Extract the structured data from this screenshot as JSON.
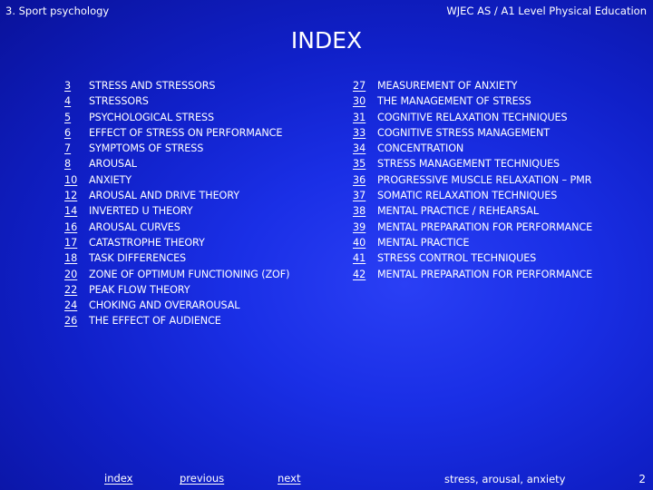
{
  "header": {
    "left": "3. Sport psychology",
    "right": "WJEC AS / A1 Level Physical Education"
  },
  "title": "INDEX",
  "left_entries": [
    {
      "page": "3",
      "label": "STRESS AND STRESSORS"
    },
    {
      "page": "4",
      "label": "STRESSORS"
    },
    {
      "page": "5",
      "label": "PSYCHOLOGICAL STRESS"
    },
    {
      "page": "6",
      "label": "EFFECT OF STRESS ON PERFORMANCE"
    },
    {
      "page": "7",
      "label": "SYMPTOMS OF STRESS"
    },
    {
      "page": "8",
      "label": "AROUSAL"
    },
    {
      "page": "10",
      "label": "ANXIETY"
    },
    {
      "page": "12",
      "label": "AROUSAL AND DRIVE THEORY"
    },
    {
      "page": "14",
      "label": "INVERTED U THEORY"
    },
    {
      "page": "16",
      "label": "AROUSAL CURVES"
    },
    {
      "page": "17",
      "label": "CATASTROPHE THEORY"
    },
    {
      "page": "18",
      "label": "TASK DIFFERENCES"
    },
    {
      "page": "20",
      "label": "ZONE OF OPTIMUM FUNCTIONING (ZOF)"
    },
    {
      "page": "22",
      "label": "PEAK FLOW THEORY"
    },
    {
      "page": "24",
      "label": "CHOKING AND OVERAROUSAL"
    },
    {
      "page": "26",
      "label": "THE EFFECT OF AUDIENCE"
    }
  ],
  "right_entries": [
    {
      "page": "27",
      "label": "MEASUREMENT OF ANXIETY"
    },
    {
      "page": "30",
      "label": "THE MANAGEMENT OF STRESS"
    },
    {
      "page": "31",
      "label": "COGNITIVE RELAXATION TECHNIQUES"
    },
    {
      "page": "33",
      "label": "COGNITIVE STRESS MANAGEMENT"
    },
    {
      "page": "34",
      "label": "CONCENTRATION"
    },
    {
      "page": "35",
      "label": "STRESS MANAGEMENT TECHNIQUES"
    },
    {
      "page": "36",
      "label": "PROGRESSIVE MUSCLE RELAXATION – PMR"
    },
    {
      "page": "37",
      "label": "SOMATIC RELAXATION TECHNIQUES"
    },
    {
      "page": "38",
      "label": "MENTAL PRACTICE / REHEARSAL"
    },
    {
      "page": "39",
      "label": "MENTAL PREPARATION FOR PERFORMANCE"
    },
    {
      "page": "40",
      "label": "MENTAL PRACTICE"
    },
    {
      "page": "41",
      "label": "STRESS CONTROL TECHNIQUES"
    },
    {
      "page": "42",
      "label": "MENTAL PREPARATION FOR PERFORMANCE"
    }
  ],
  "nav": {
    "index": "index",
    "previous": "previous",
    "next": "next"
  },
  "footer": {
    "topic": "stress, arousal, anxiety",
    "page_number": "2"
  }
}
